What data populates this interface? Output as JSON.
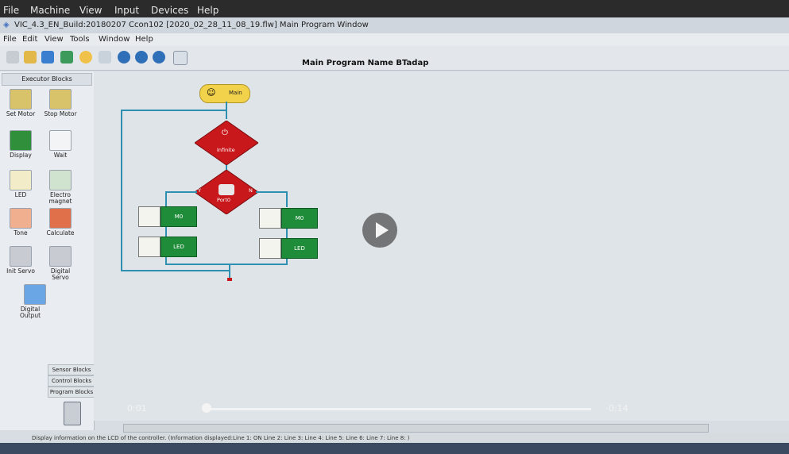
{
  "host_menu": [
    "File",
    "Machine",
    "View",
    "Input",
    "Devices",
    "Help"
  ],
  "window": {
    "title": "VIC_4.3_EN_Build:20180207   Ccon102   [2020_02_28_11_08_19.flw]   Main Program Window"
  },
  "app_menu": [
    "File",
    "Edit",
    "View",
    "Tools",
    "Window",
    "Help"
  ],
  "program_name": "Main Program Name  BTadap",
  "palette": {
    "title": "Executor Blocks",
    "blocks": [
      "Set Motor",
      "Stop Motor",
      "Display",
      "Wait",
      "LED",
      "Electro magnet",
      "Tone",
      "Calculate",
      "Init Servo",
      "Digital Servo",
      "Digital Output"
    ],
    "tabs": [
      "Sensor Blocks",
      "Control Blocks",
      "Program Blocks"
    ]
  },
  "flow": {
    "main": "Main",
    "loop": "Infinite",
    "condition": "Port0",
    "yes": "Y",
    "no": "N",
    "left_motor": "M0",
    "right_motor": "M0",
    "left_led": "LED",
    "right_led": "LED"
  },
  "video": {
    "elapsed": "0:01",
    "remaining": "-0:14"
  },
  "status": "Display information on the LCD of the controller. (Information displayed:Line 1: ON Line 2:  Line 3:  Line 4:  Line 5:  Line 6:  Line 7:  Line 8: )",
  "colors": {
    "green": "#1f8c3a",
    "red": "#c8181c",
    "yellow": "#f2d24a",
    "line": "#2f8fb0"
  }
}
